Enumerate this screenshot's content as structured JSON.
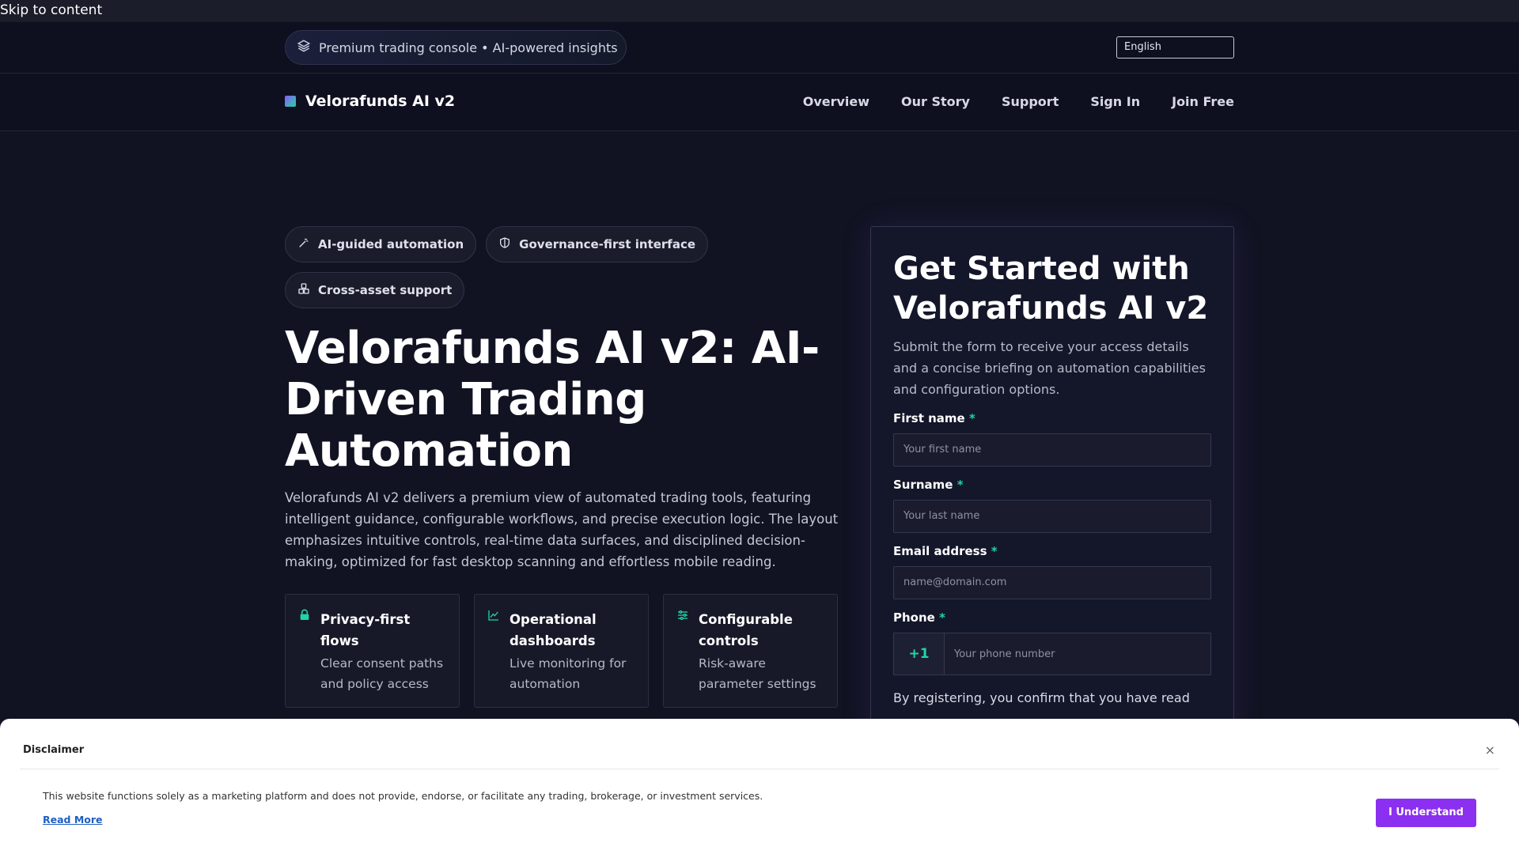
{
  "skip_link": "Skip to content",
  "topbar": {
    "pill_text": "Premium trading console • AI-powered insights",
    "language": "English"
  },
  "nav": {
    "brand": "Velorafunds AI v2",
    "links": [
      "Overview",
      "Our Story",
      "Support",
      "Sign In",
      "Join Free"
    ]
  },
  "hero": {
    "badges": [
      {
        "icon": "magic-wand-icon",
        "label": "AI-guided automation"
      },
      {
        "icon": "shield-icon",
        "label": "Governance-first interface"
      },
      {
        "icon": "assets-icon",
        "label": "Cross-asset support"
      }
    ],
    "title": "Velorafunds AI v2: AI-Driven Trading Automation",
    "description": "Velorafunds AI v2 delivers a premium view of automated trading tools, featuring intelligent guidance, configurable workflows, and precise execution logic. The layout emphasizes intuitive controls, real-time data surfaces, and disciplined decision-making, optimized for fast desktop scanning and effortless mobile reading.",
    "features": [
      {
        "icon": "lock-icon",
        "title": "Privacy-first flows",
        "text": "Clear consent paths and policy access"
      },
      {
        "icon": "chart-line-icon",
        "title": "Operational dashboards",
        "text": "Live monitoring for automation"
      },
      {
        "icon": "sliders-icon",
        "title": "Configurable controls",
        "text": "Risk-aware parameter settings"
      }
    ]
  },
  "form": {
    "title": "Get Started with Velorafunds AI v2",
    "description": "Submit the form to receive your access details and a concise briefing on automation capabilities and configuration options.",
    "first_name_label": "First name",
    "first_name_placeholder": "Your first name",
    "surname_label": "Surname",
    "surname_placeholder": "Your last name",
    "email_label": "Email address",
    "email_placeholder": "name@domain.com",
    "phone_label": "Phone",
    "phone_code": "+1",
    "phone_placeholder": "Your phone number",
    "required_mark": "*",
    "consent": "By registering, you confirm that you have read"
  },
  "disclaimer": {
    "title": "Disclaimer",
    "close": "×",
    "text": "This website functions solely as a marketing platform and does not provide, endorse, or facilitate any trading, brokerage, or investment services.",
    "read_more": "Read More",
    "button": "I Understand"
  },
  "colors": {
    "background": "#111322",
    "accent_green": "#22d3a6",
    "accent_purple": "#8b2ff0"
  }
}
